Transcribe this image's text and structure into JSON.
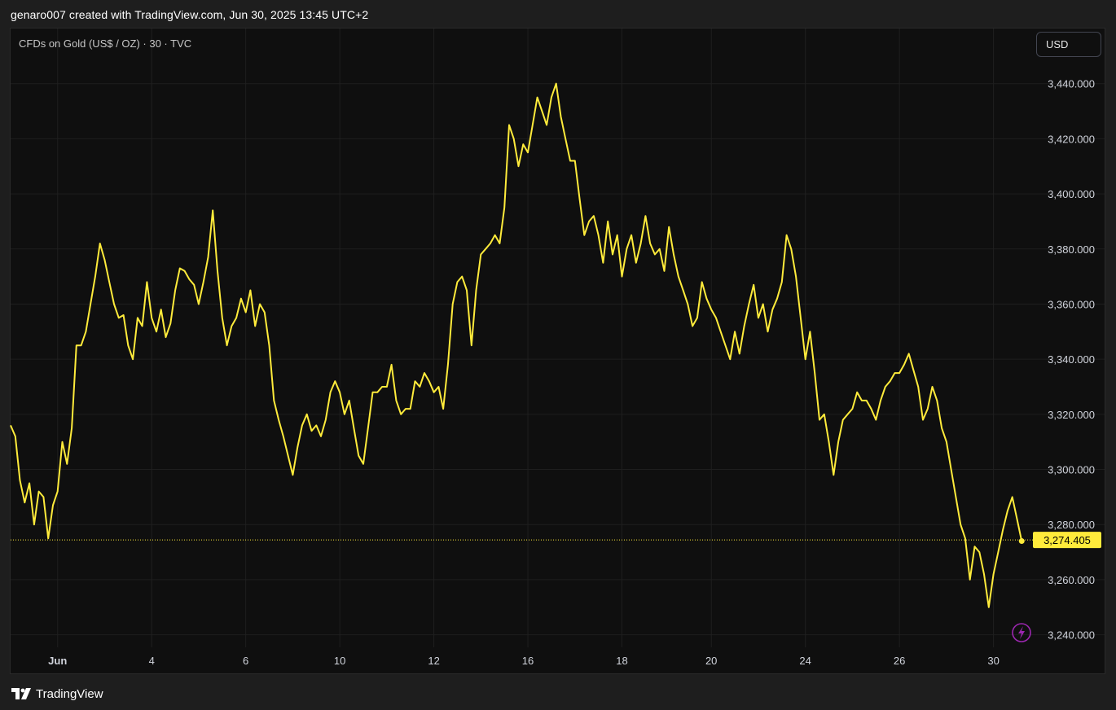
{
  "caption": "genaro007 created with TradingView.com, Jun 30, 2025 13:45 UTC+2",
  "symbol_label": "CFDs on Gold (US$ / OZ) · 30 · TVC",
  "currency_button": "USD",
  "footer_brand": "TradingView",
  "colors": {
    "line": "#ffeb3b",
    "background": "#0f0f0f",
    "grid": "#1f1f1f",
    "lightning_icon": "#9c27b0"
  },
  "icons": [
    "tradingview-logo-icon",
    "lightning-icon"
  ],
  "chart_data": {
    "type": "line",
    "title": "CFDs on Gold (US$ / OZ) · 30 · TVC",
    "xlabel": "",
    "ylabel": "",
    "ylim": [
      3226,
      3460
    ],
    "grid": true,
    "last_value": 3274.405,
    "last_value_label": "3,274.405",
    "y_ticks": [
      3240,
      3260,
      3280,
      3300,
      3320,
      3340,
      3360,
      3380,
      3400,
      3420,
      3440
    ],
    "y_tick_labels": [
      "3,240.000",
      "3,260.000",
      "3,280.000",
      "3,300.000",
      "3,320.000",
      "3,340.000",
      "3,360.000",
      "3,380.000",
      "3,400.000",
      "3,420.000",
      "3,440.000"
    ],
    "x_ticks": [
      {
        "label": "Jun",
        "x": 10
      },
      {
        "label": "4",
        "x": 30
      },
      {
        "label": "6",
        "x": 50
      },
      {
        "label": "10",
        "x": 70
      },
      {
        "label": "12",
        "x": 90
      },
      {
        "label": "16",
        "x": 110
      },
      {
        "label": "18",
        "x": 130
      },
      {
        "label": "20",
        "x": 149
      },
      {
        "label": "24",
        "x": 169
      },
      {
        "label": "26",
        "x": 189
      },
      {
        "label": "30",
        "x": 209
      }
    ],
    "xlim": [
      0,
      216
    ],
    "series": [
      {
        "points": [
          [
            0,
            3316
          ],
          [
            1,
            3312
          ],
          [
            2,
            3296
          ],
          [
            3,
            3288
          ],
          [
            4,
            3295
          ],
          [
            5,
            3280
          ],
          [
            6,
            3292
          ],
          [
            7,
            3290
          ],
          [
            8,
            3275
          ],
          [
            9,
            3287
          ],
          [
            10,
            3292
          ],
          [
            11,
            3310
          ],
          [
            12,
            3302
          ],
          [
            13,
            3315
          ],
          [
            14,
            3345
          ],
          [
            15,
            3345
          ],
          [
            16,
            3350
          ],
          [
            17,
            3360
          ],
          [
            18,
            3370
          ],
          [
            19,
            3382
          ],
          [
            20,
            3376
          ],
          [
            21,
            3368
          ],
          [
            22,
            3360
          ],
          [
            23,
            3355
          ],
          [
            24,
            3356
          ],
          [
            25,
            3345
          ],
          [
            26,
            3340
          ],
          [
            27,
            3355
          ],
          [
            28,
            3352
          ],
          [
            29,
            3368
          ],
          [
            30,
            3355
          ],
          [
            31,
            3350
          ],
          [
            32,
            3358
          ],
          [
            33,
            3348
          ],
          [
            34,
            3353
          ],
          [
            35,
            3365
          ],
          [
            36,
            3373
          ],
          [
            37,
            3372
          ],
          [
            38,
            3369
          ],
          [
            39,
            3367
          ],
          [
            40,
            3360
          ],
          [
            41,
            3368
          ],
          [
            42,
            3377
          ],
          [
            43,
            3394
          ],
          [
            44,
            3372
          ],
          [
            45,
            3355
          ],
          [
            46,
            3345
          ],
          [
            47,
            3352
          ],
          [
            48,
            3355
          ],
          [
            49,
            3362
          ],
          [
            50,
            3357
          ],
          [
            51,
            3365
          ],
          [
            52,
            3352
          ],
          [
            53,
            3360
          ],
          [
            54,
            3357
          ],
          [
            55,
            3345
          ],
          [
            56,
            3325
          ],
          [
            57,
            3318
          ],
          [
            58,
            3312
          ],
          [
            59,
            3305
          ],
          [
            60,
            3298
          ],
          [
            61,
            3308
          ],
          [
            62,
            3316
          ],
          [
            63,
            3320
          ],
          [
            64,
            3314
          ],
          [
            65,
            3316
          ],
          [
            66,
            3312
          ],
          [
            67,
            3318
          ],
          [
            68,
            3328
          ],
          [
            69,
            3332
          ],
          [
            70,
            3328
          ],
          [
            71,
            3320
          ],
          [
            72,
            3325
          ],
          [
            73,
            3315
          ],
          [
            74,
            3305
          ],
          [
            75,
            3302
          ],
          [
            76,
            3315
          ],
          [
            77,
            3328
          ],
          [
            78,
            3328
          ],
          [
            79,
            3330
          ],
          [
            80,
            3330
          ],
          [
            81,
            3338
          ],
          [
            82,
            3325
          ],
          [
            83,
            3320
          ],
          [
            84,
            3322
          ],
          [
            85,
            3322
          ],
          [
            86,
            3332
          ],
          [
            87,
            3330
          ],
          [
            88,
            3335
          ],
          [
            89,
            3332
          ],
          [
            90,
            3328
          ],
          [
            91,
            3330
          ],
          [
            92,
            3322
          ],
          [
            93,
            3338
          ],
          [
            94,
            3360
          ],
          [
            95,
            3368
          ],
          [
            96,
            3370
          ],
          [
            97,
            3365
          ],
          [
            98,
            3345
          ],
          [
            99,
            3365
          ],
          [
            100,
            3378
          ],
          [
            101,
            3380
          ],
          [
            102,
            3382
          ],
          [
            103,
            3385
          ],
          [
            104,
            3382
          ],
          [
            105,
            3395
          ],
          [
            106,
            3425
          ],
          [
            107,
            3420
          ],
          [
            108,
            3410
          ],
          [
            109,
            3418
          ],
          [
            110,
            3415
          ],
          [
            111,
            3425
          ],
          [
            112,
            3435
          ],
          [
            113,
            3430
          ],
          [
            114,
            3425
          ],
          [
            115,
            3435
          ],
          [
            116,
            3440
          ],
          [
            117,
            3428
          ],
          [
            118,
            3420
          ],
          [
            119,
            3412
          ],
          [
            120,
            3412
          ],
          [
            121,
            3398
          ],
          [
            122,
            3385
          ],
          [
            123,
            3390
          ],
          [
            124,
            3392
          ],
          [
            125,
            3385
          ],
          [
            126,
            3375
          ],
          [
            127,
            3390
          ],
          [
            128,
            3378
          ],
          [
            129,
            3385
          ],
          [
            130,
            3370
          ],
          [
            131,
            3380
          ],
          [
            132,
            3385
          ],
          [
            133,
            3375
          ],
          [
            134,
            3382
          ],
          [
            135,
            3392
          ],
          [
            136,
            3382
          ],
          [
            137,
            3378
          ],
          [
            138,
            3380
          ],
          [
            139,
            3372
          ],
          [
            140,
            3388
          ],
          [
            141,
            3378
          ],
          [
            142,
            3370
          ],
          [
            143,
            3365
          ],
          [
            144,
            3360
          ],
          [
            145,
            3352
          ],
          [
            146,
            3355
          ],
          [
            147,
            3368
          ],
          [
            148,
            3362
          ],
          [
            149,
            3358
          ],
          [
            150,
            3355
          ],
          [
            151,
            3350
          ],
          [
            152,
            3345
          ],
          [
            153,
            3340
          ],
          [
            154,
            3350
          ],
          [
            155,
            3342
          ],
          [
            156,
            3352
          ],
          [
            157,
            3360
          ],
          [
            158,
            3367
          ],
          [
            159,
            3355
          ],
          [
            160,
            3360
          ],
          [
            161,
            3350
          ],
          [
            162,
            3358
          ],
          [
            163,
            3362
          ],
          [
            164,
            3368
          ],
          [
            165,
            3385
          ],
          [
            166,
            3380
          ],
          [
            167,
            3370
          ],
          [
            168,
            3355
          ],
          [
            169,
            3340
          ],
          [
            170,
            3350
          ],
          [
            171,
            3335
          ],
          [
            172,
            3318
          ],
          [
            173,
            3320
          ],
          [
            174,
            3310
          ],
          [
            175,
            3298
          ],
          [
            176,
            3310
          ],
          [
            177,
            3318
          ],
          [
            178,
            3320
          ],
          [
            179,
            3322
          ],
          [
            180,
            3328
          ],
          [
            181,
            3325
          ],
          [
            182,
            3325
          ],
          [
            183,
            3322
          ],
          [
            184,
            3318
          ],
          [
            185,
            3325
          ],
          [
            186,
            3330
          ],
          [
            187,
            3332
          ],
          [
            188,
            3335
          ],
          [
            189,
            3335
          ],
          [
            190,
            3338
          ],
          [
            191,
            3342
          ],
          [
            192,
            3336
          ],
          [
            193,
            3330
          ],
          [
            194,
            3318
          ],
          [
            195,
            3322
          ],
          [
            196,
            3330
          ],
          [
            197,
            3325
          ],
          [
            198,
            3315
          ],
          [
            199,
            3310
          ],
          [
            200,
            3300
          ],
          [
            201,
            3290
          ],
          [
            202,
            3280
          ],
          [
            203,
            3275
          ],
          [
            204,
            3260
          ],
          [
            205,
            3272
          ],
          [
            206,
            3270
          ],
          [
            207,
            3262
          ],
          [
            208,
            3250
          ],
          [
            209,
            3262
          ],
          [
            210,
            3270
          ],
          [
            211,
            3278
          ],
          [
            212,
            3285
          ],
          [
            213,
            3290
          ],
          [
            214,
            3282
          ],
          [
            215,
            3274
          ]
        ]
      }
    ]
  }
}
